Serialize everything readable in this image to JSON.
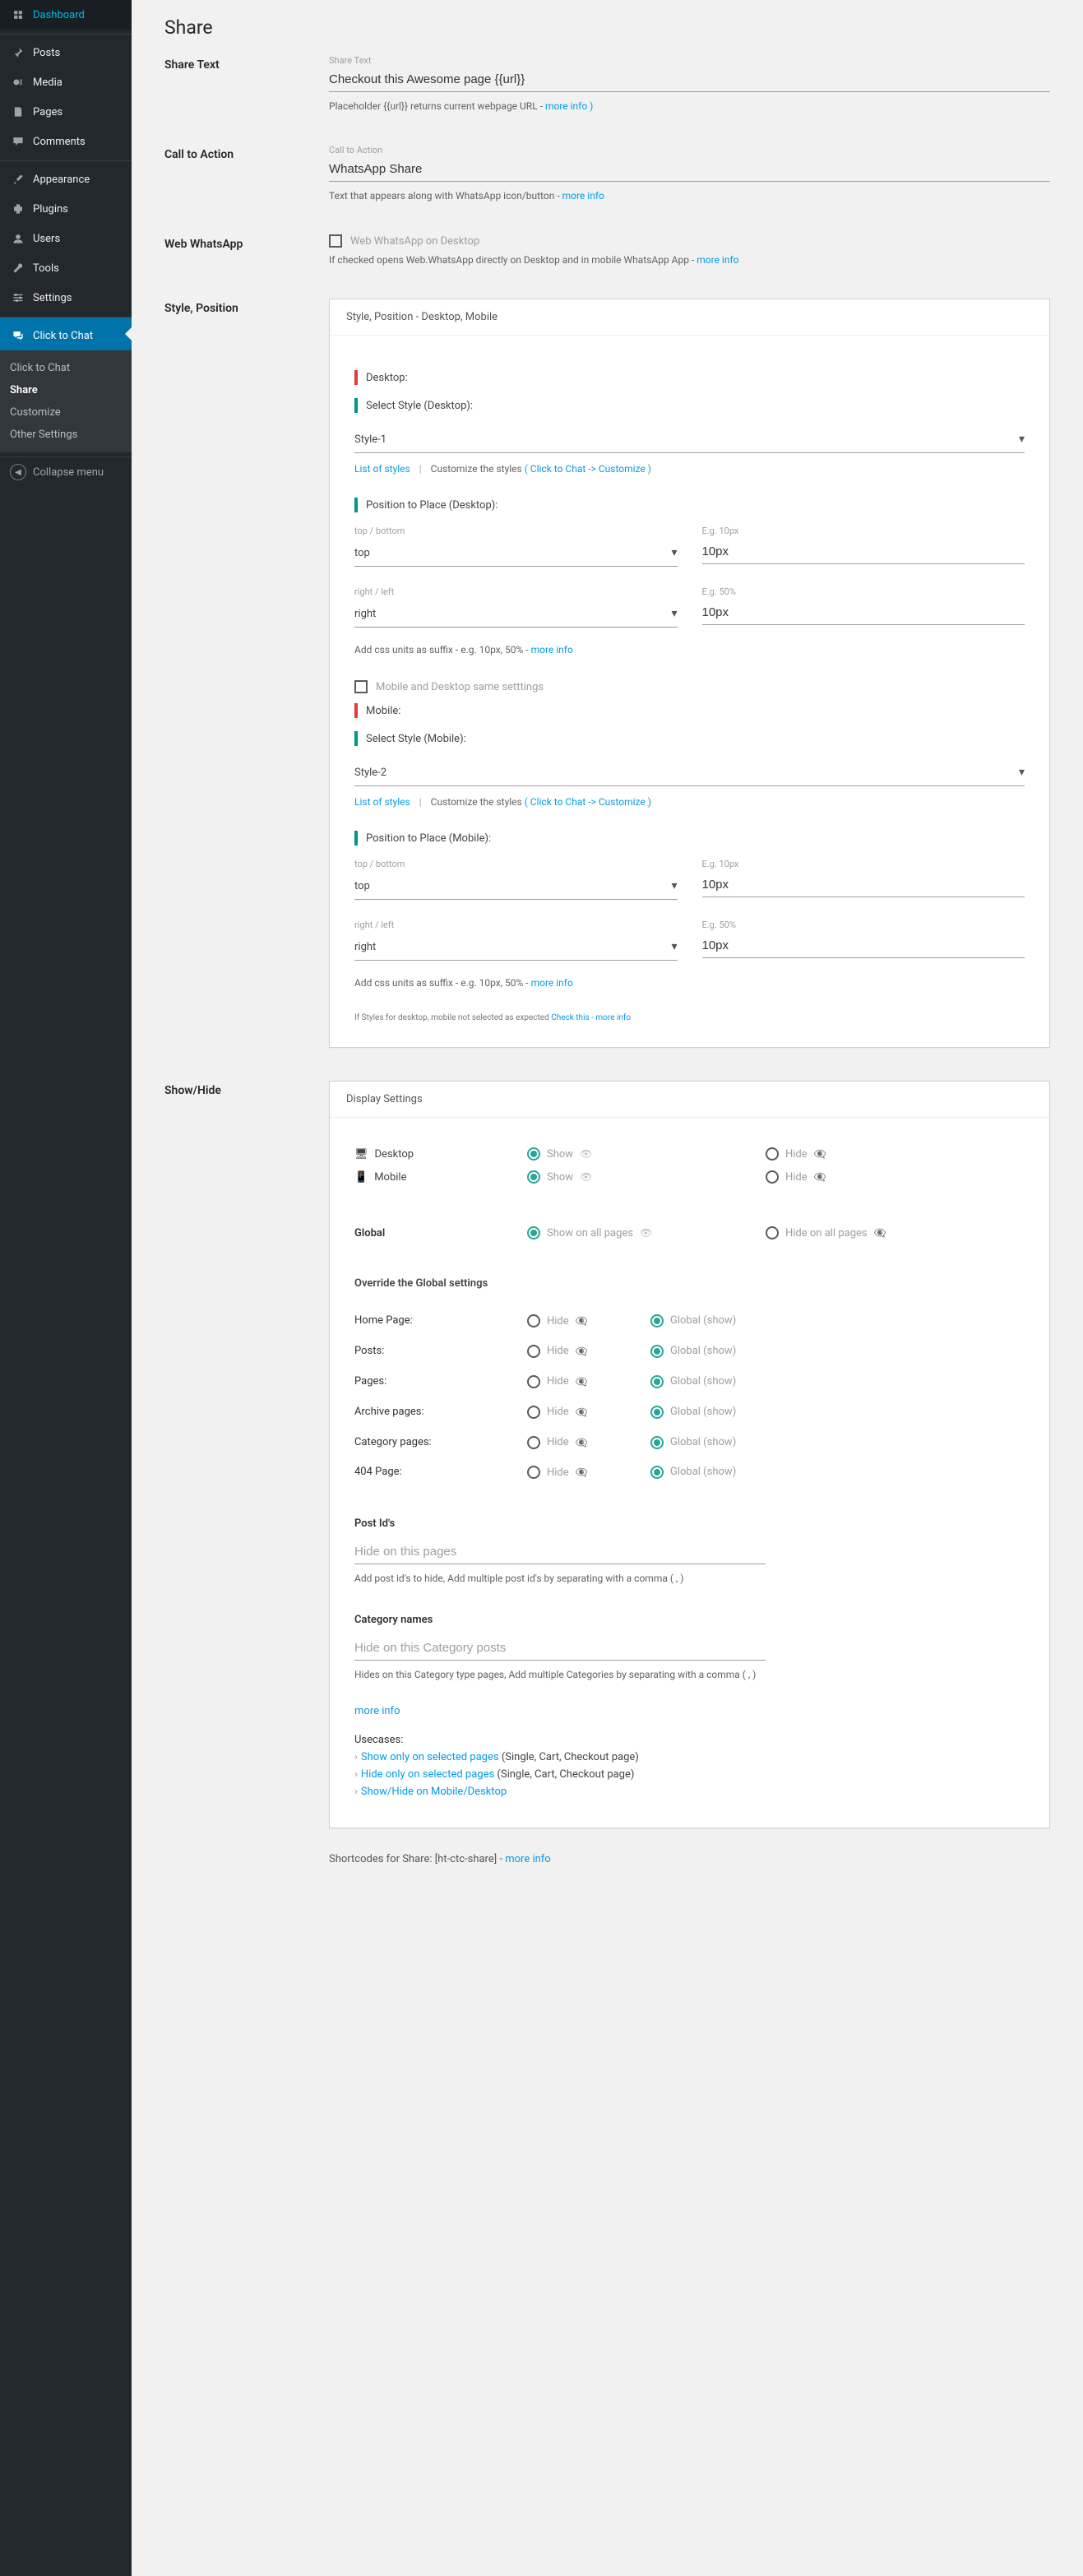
{
  "sidebar": {
    "items": [
      {
        "label": "Dashboard"
      },
      {
        "label": "Posts"
      },
      {
        "label": "Media"
      },
      {
        "label": "Pages"
      },
      {
        "label": "Comments"
      },
      {
        "label": "Appearance"
      },
      {
        "label": "Plugins"
      },
      {
        "label": "Users"
      },
      {
        "label": "Tools"
      },
      {
        "label": "Settings"
      },
      {
        "label": "Click to Chat"
      }
    ],
    "submenu": [
      {
        "label": "Click to Chat"
      },
      {
        "label": "Share"
      },
      {
        "label": "Customize"
      },
      {
        "label": "Other Settings"
      }
    ],
    "collapse": "Collapse menu"
  },
  "page": {
    "title": "Share"
  },
  "share_text": {
    "row_label": "Share Text",
    "field_label": "Share Text",
    "value": "Checkout this Awesome page {{url}}",
    "helper_pre": "Placeholder {{url}} returns current webpage URL - ",
    "helper_link": "more info )"
  },
  "cta": {
    "row_label": "Call to Action",
    "field_label": "Call to Action",
    "value": "WhatsApp Share",
    "helper_pre": "Text that appears along with WhatsApp icon/button - ",
    "helper_link": "more info"
  },
  "web": {
    "row_label": "Web WhatsApp",
    "chk_label": "Web WhatsApp on Desktop",
    "helper_pre": "If checked opens Web.WhatsApp directly on Desktop and in mobile WhatsApp App - ",
    "helper_link": "more info"
  },
  "style_pos": {
    "row_label": "Style, Position",
    "card_title": "Style, Position - Desktop, Mobile",
    "desktop": "Desktop:",
    "sel_style_d": "Select Style (Desktop):",
    "style_d_val": "Style-1",
    "list_styles": "List of styles",
    "customize_pre": "Customize the styles ",
    "customize_link": "( Click to Chat -> Customize )",
    "pos_d": "Position to Place (Desktop):",
    "tb_lbl": "top / bottom",
    "tb_val_d": "top",
    "px10_lbl": "E.g. 10px",
    "px10_val": "10px",
    "rl_lbl": "right / left",
    "rl_val_d": "right",
    "px50_lbl": "E.g. 50%",
    "css_suffix": "Add css units as suffix - e.g. 10px, 50% - ",
    "more_info": "more info",
    "chk_same": "Mobile and Desktop same setttings",
    "mobile": "Mobile:",
    "sel_style_m": "Select Style (Mobile):",
    "style_m_val": "Style-2",
    "pos_m": "Position to Place (Mobile):",
    "tb_val_m": "top",
    "rl_val_m": "right",
    "tiny_pre": "If Styles for desktop, mobile not selected as expected ",
    "tiny_check": "Check this",
    "tiny_more": " - more info"
  },
  "showhide": {
    "row_label": "Show/Hide",
    "card_title": "Display Settings",
    "desktop_lbl": "Desktop",
    "mobile_lbl": "Mobile",
    "show": "Show",
    "hide": "Hide",
    "global_lbl": "Global",
    "show_all": "Show on all pages",
    "hide_all": "Hide on all pages",
    "override": "Override the Global settings",
    "hide_txt": "Hide",
    "global_show": "Global (show)",
    "rows": {
      "home": "Home Page:",
      "posts": "Posts:",
      "pages": "Pages:",
      "archive": "Archive pages:",
      "category": "Category pages:",
      "404": "404 Page:"
    },
    "post_ids_lbl": "Post Id's",
    "post_ids_ph": "Hide on this pages",
    "post_ids_help": "Add post id's to hide, Add multiple post id's by separating with a comma ( , )",
    "cat_lbl": "Category names",
    "cat_ph": "Hide on this Category posts",
    "cat_help": "Hides on this Category type pages, Add multiple Categories by separating with a comma ( , )",
    "more_info": "more info",
    "usecases_lbl": "Usecases:",
    "uc1_link": "Show only on selected pages",
    "uc1_suf": " (Single, Cart, Checkout page)",
    "uc2_link": "Hide only on selected pages",
    "uc2_suf": " (Single, Cart, Checkout page)",
    "uc3_link": "Show/Hide on Mobile/Desktop"
  },
  "footer": {
    "pre": "Shortcodes for Share: [ht-ctc-share] - ",
    "link": "more info"
  }
}
